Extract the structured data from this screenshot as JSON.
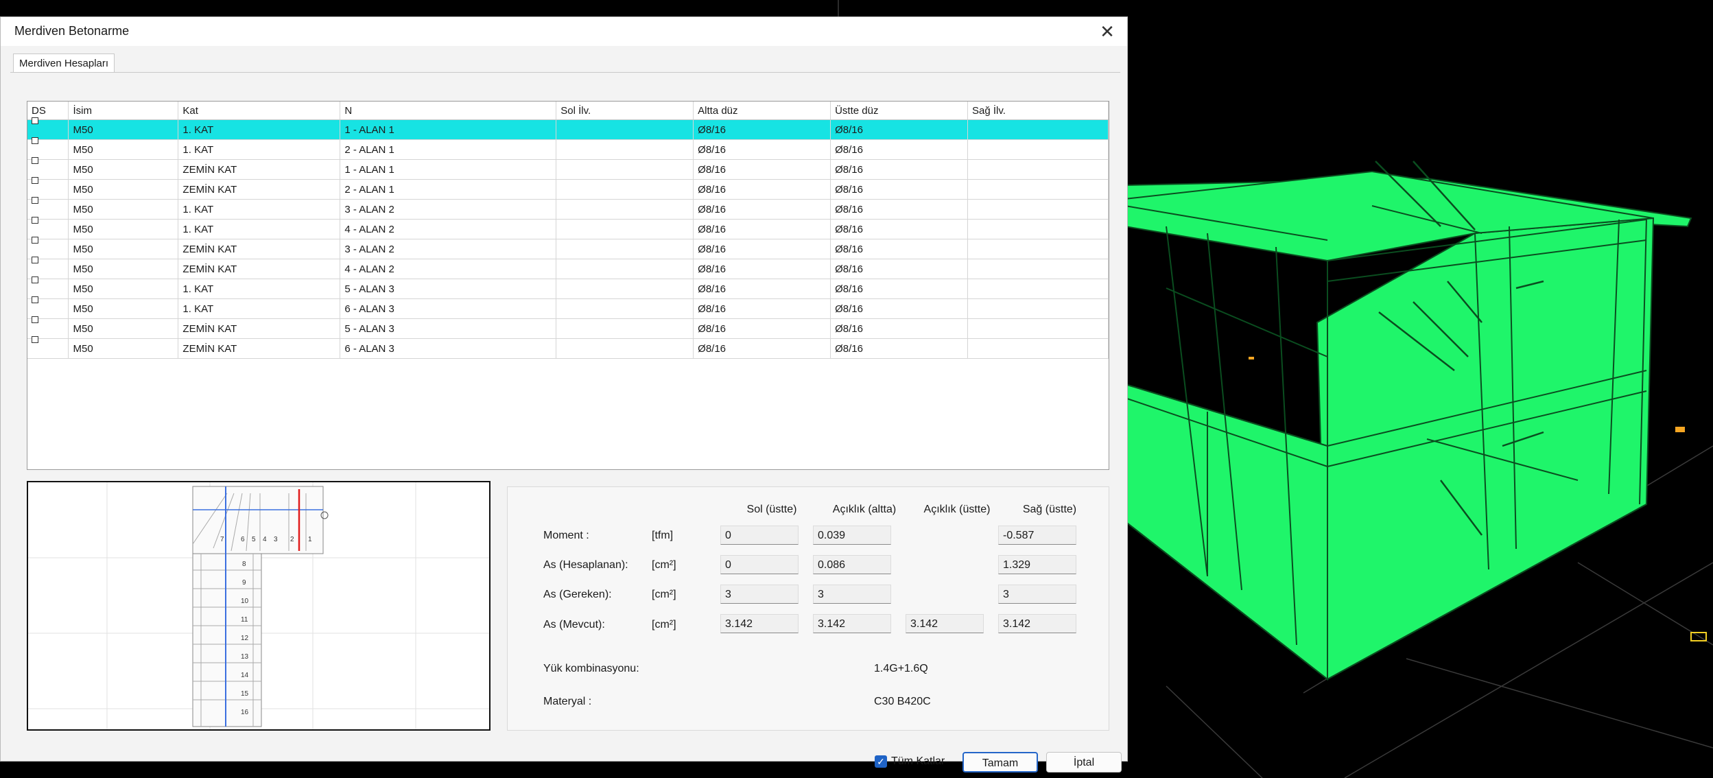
{
  "window": {
    "title": "Merdiven Betonarme"
  },
  "tab": {
    "label": "Merdiven Hesapları"
  },
  "table": {
    "columns": [
      "DS",
      "İsim",
      "Kat",
      "N",
      "Sol İlv.",
      "Altta düz",
      "Üstte düz",
      "Sağ İlv."
    ],
    "rows": [
      [
        "",
        "M50",
        "1. KAT",
        "1 - ALAN 1",
        "",
        "Ø8/16",
        "Ø8/16",
        ""
      ],
      [
        "",
        "M50",
        "1. KAT",
        "2 - ALAN 1",
        "",
        "Ø8/16",
        "Ø8/16",
        ""
      ],
      [
        "",
        "M50",
        "ZEMİN KAT",
        "1 - ALAN 1",
        "",
        "Ø8/16",
        "Ø8/16",
        ""
      ],
      [
        "",
        "M50",
        "ZEMİN KAT",
        "2 - ALAN 1",
        "",
        "Ø8/16",
        "Ø8/16",
        ""
      ],
      [
        "",
        "M50",
        "1. KAT",
        "3 - ALAN 2",
        "",
        "Ø8/16",
        "Ø8/16",
        ""
      ],
      [
        "",
        "M50",
        "1. KAT",
        "4 - ALAN 2",
        "",
        "Ø8/16",
        "Ø8/16",
        ""
      ],
      [
        "",
        "M50",
        "ZEMİN KAT",
        "3 - ALAN 2",
        "",
        "Ø8/16",
        "Ø8/16",
        ""
      ],
      [
        "",
        "M50",
        "ZEMİN KAT",
        "4 - ALAN 2",
        "",
        "Ø8/16",
        "Ø8/16",
        ""
      ],
      [
        "",
        "M50",
        "1. KAT",
        "5 - ALAN 3",
        "",
        "Ø8/16",
        "Ø8/16",
        ""
      ],
      [
        "",
        "M50",
        "1. KAT",
        "6 - ALAN 3",
        "",
        "Ø8/16",
        "Ø8/16",
        ""
      ],
      [
        "",
        "M50",
        "ZEMİN KAT",
        "5 - ALAN 3",
        "",
        "Ø8/16",
        "Ø8/16",
        ""
      ],
      [
        "",
        "M50",
        "ZEMİN KAT",
        "6 - ALAN 3",
        "",
        "Ø8/16",
        "Ø8/16",
        ""
      ]
    ],
    "selected_row": 0
  },
  "preview": {
    "step_numbers_top": [
      "7",
      "6",
      "5",
      "4",
      "3",
      "2",
      "1"
    ],
    "step_numbers_flight": [
      "8",
      "9",
      "10",
      "11",
      "12",
      "13",
      "14",
      "15",
      "16"
    ]
  },
  "results": {
    "headers": [
      "Sol (üstte)",
      "Açıklık (altta)",
      "Açıklık (üstte)",
      "Sağ (üstte)"
    ],
    "rows": [
      {
        "label": "Moment :",
        "unit": "[tfm]",
        "values": [
          "0",
          "0.039",
          "",
          "-0.587"
        ]
      },
      {
        "label": "As (Hesaplanan):",
        "unit": "[cm²]",
        "values": [
          "0",
          "0.086",
          "",
          "1.329"
        ]
      },
      {
        "label": "As (Gereken):",
        "unit": "[cm²]",
        "values": [
          "3",
          "3",
          "",
          "3"
        ]
      },
      {
        "label": "As (Mevcut):",
        "unit": "[cm²]",
        "values": [
          "3.142",
          "3.142",
          "3.142",
          "3.142"
        ]
      }
    ],
    "load_combination_label": "Yük kombinasyonu:",
    "load_combination_value": "1.4G+1.6Q",
    "material_label": "Materyal :",
    "material_value": "C30 B420C"
  },
  "footer": {
    "all_floors_label": "Tüm Katlar",
    "all_floors_checked": true,
    "ok_label": "Tamam",
    "cancel_label": "İptal"
  },
  "colors": {
    "selection": "#17e3e3",
    "structure": "#1ff56a",
    "accent": "#2466c9"
  }
}
